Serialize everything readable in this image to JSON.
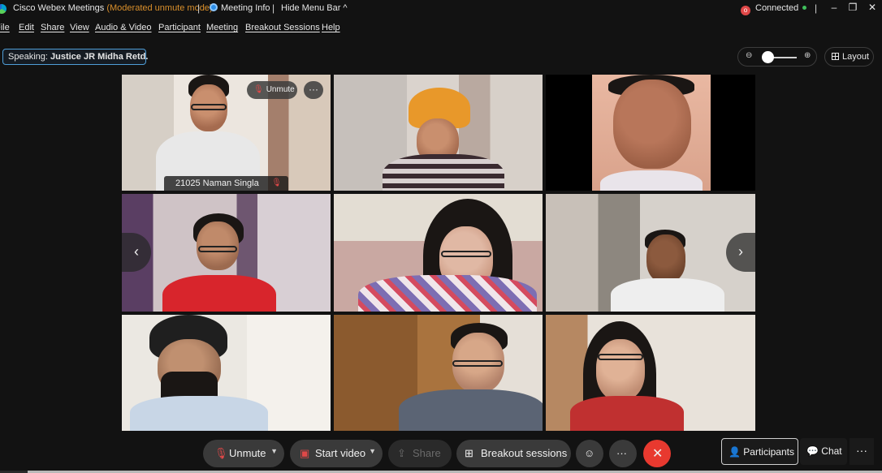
{
  "titlebar": {
    "app_name": "Cisco Webex Meetings",
    "mode": "(Moderated unmute mode)",
    "sep1": "|",
    "meeting_info": "Meeting Info",
    "sep2": "|",
    "hide_menu_bar": "Hide Menu Bar ^",
    "connection_badge": "o",
    "connection_status": "Connected",
    "sep3": "|",
    "minimize": "–",
    "restore": "❐",
    "close": "✕"
  },
  "menubar": {
    "items": [
      "File",
      "Edit",
      "Share",
      "View",
      "Audio & Video",
      "Participant",
      "Meeting",
      "Breakout Sessions",
      "Help"
    ]
  },
  "speaking": {
    "prefix": "Speaking:",
    "name": "Justice JR Midha Retd."
  },
  "zoom": {
    "zoom_out": "⊖",
    "zoom_in": "⊕",
    "level": 0.3
  },
  "layout_button": "Layout",
  "active_tile": {
    "unmute_label": "Unmute",
    "more_label": "···",
    "name": "21025 Naman Singla"
  },
  "nav": {
    "prev": "‹",
    "next": "›"
  },
  "controls": {
    "unmute": "Unmute",
    "start_video": "Start video",
    "share": "Share",
    "breakout": "Breakout sessions",
    "reactions": "☺",
    "more": "···",
    "end": "✕"
  },
  "panel": {
    "participants": "Participants",
    "chat": "Chat",
    "more": "···"
  },
  "colors": {
    "background": "#121212",
    "accent_blue": "#4f9ed8",
    "mode_orange": "#d98f2b",
    "mute_red": "#e04848",
    "end_red": "#e8392f",
    "connected_green": "#3fbf5b"
  }
}
